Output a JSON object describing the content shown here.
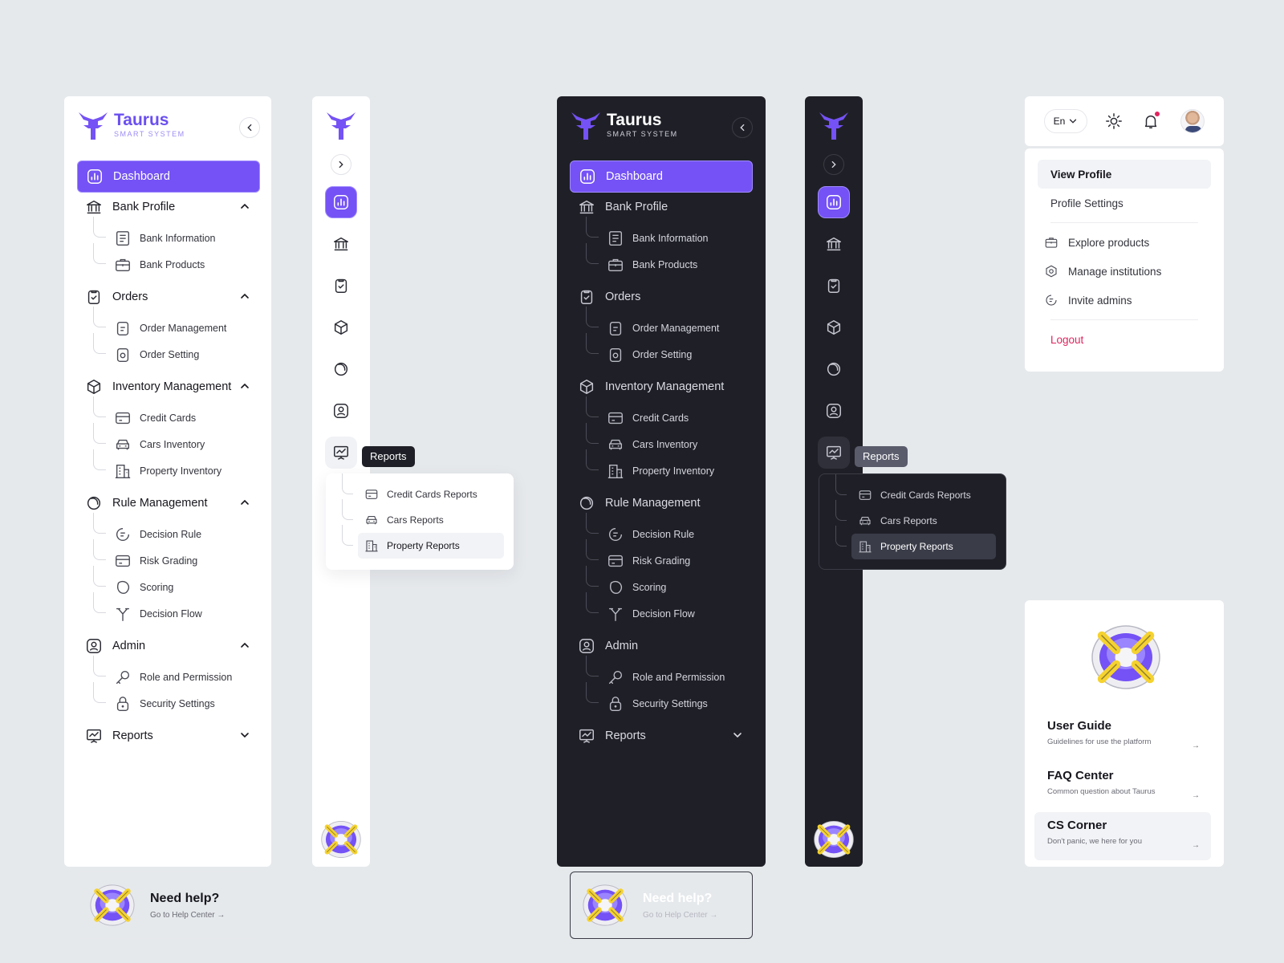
{
  "brand": {
    "name": "Taurus",
    "tagline": "SMART SYSTEM"
  },
  "colors": {
    "accent": "#7452f5",
    "dark_bg": "#1f2027",
    "logout": "#e0245e",
    "help_yellow": "#f5d22e"
  },
  "nav": {
    "dashboard": "Dashboard",
    "bank_profile": "Bank Profile",
    "bank_information": "Bank Information",
    "bank_products": "Bank Products",
    "orders": "Orders",
    "order_management": "Order Management",
    "order_setting": "Order Setting",
    "inventory": "Inventory Management",
    "credit_cards": "Credit Cards",
    "cars_inventory": "Cars Inventory",
    "property_inventory": "Property Inventory",
    "rule_management": "Rule Management",
    "decision_rule": "Decision Rule",
    "risk_grading": "Risk Grading",
    "scoring": "Scoring",
    "decision_flow": "Decision Flow",
    "admin": "Admin",
    "role_permission": "Role and Permission",
    "security_settings": "Security Settings",
    "reports": "Reports"
  },
  "help": {
    "title": "Need help?",
    "link": "Go to Help Center →"
  },
  "reports_flyout": {
    "tooltip": "Reports",
    "items": [
      "Credit Cards Reports",
      "Cars Reports",
      "Property Reports"
    ]
  },
  "topbar": {
    "language": "En"
  },
  "profile_menu": {
    "view_profile": "View Profile",
    "profile_settings": "Profile Settings",
    "explore": "Explore products",
    "manage": "Manage institutions",
    "invite": "Invite admins",
    "logout": "Logout"
  },
  "guides": {
    "user_guide": {
      "title": "User Guide",
      "desc": "Guidelines for use the platform"
    },
    "faq": {
      "title": "FAQ Center",
      "desc": "Common question about Taurus"
    },
    "cs": {
      "title": "CS Corner",
      "desc": "Don't panic, we here for you"
    }
  }
}
